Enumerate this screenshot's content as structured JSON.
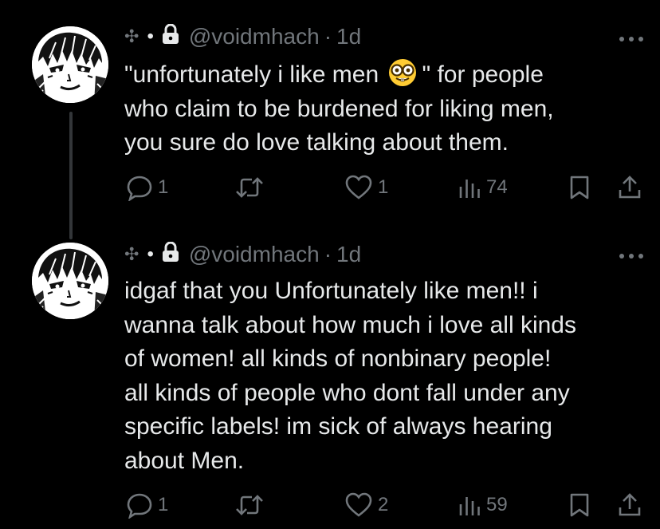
{
  "tweets": [
    {
      "author": {
        "handle": "@voidmhach",
        "prefix_glyph": "✣",
        "separator_dot": "•",
        "locked": true
      },
      "time": "1d",
      "time_separator": "·",
      "text_lines": [
        "\"unfortunately i like men ",
        "\" for people",
        "who claim to be burdened for liking men,",
        "you sure do love talking about them."
      ],
      "emoji": "nerd-face-icon",
      "stats": {
        "replies": "1",
        "reposts": "",
        "likes": "1",
        "views": "74"
      }
    },
    {
      "author": {
        "handle": "@voidmhach",
        "prefix_glyph": "✣",
        "separator_dot": "•",
        "locked": true
      },
      "time": "1d",
      "time_separator": "·",
      "text_lines": [
        "idgaf that you Unfortunately like men!! i",
        "wanna talk about how much i love all kinds",
        "of women! all kinds of nonbinary people!",
        "all kinds of people who dont fall under any",
        "specific labels! im sick of always hearing",
        "about Men."
      ],
      "stats": {
        "replies": "1",
        "reposts": "",
        "likes": "2",
        "views": "59"
      }
    }
  ],
  "colors": {
    "background": "#000000",
    "text_primary": "#e7e9ea",
    "text_secondary": "#71767b",
    "thread_line": "#333639"
  }
}
